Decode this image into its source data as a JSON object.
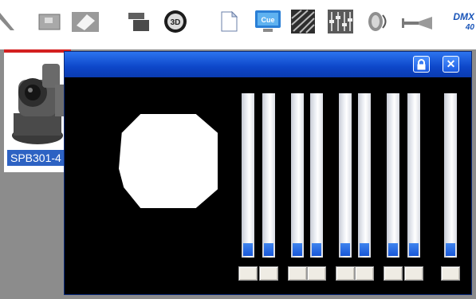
{
  "toolbar": {
    "buttons": [
      {
        "name": "arrow-tool-icon"
      },
      {
        "name": "window-tool-icon"
      },
      {
        "name": "diamond-tool-icon"
      },
      {
        "name": "stack-tool-icon"
      },
      {
        "name": "3d-tool-icon",
        "label": "3D"
      },
      {
        "name": "document-icon"
      },
      {
        "name": "cue-monitor-icon",
        "label": "Cue"
      },
      {
        "name": "striped-panel-icon"
      },
      {
        "name": "mixer-faders-icon"
      },
      {
        "name": "speaker-icon"
      },
      {
        "name": "strobe-icon"
      }
    ],
    "brand_line1": "DMX",
    "brand_line2": "40"
  },
  "device": {
    "label": "SPB301-4"
  },
  "window": {
    "lock_icon": "lock-icon",
    "close_icon": "close-icon",
    "close_glyph": "✕"
  },
  "sliders": [
    {
      "name": "fader-1",
      "level": 0.08
    },
    {
      "name": "fader-2",
      "level": 0.08
    },
    {
      "name": "fader-3",
      "level": 0.08
    },
    {
      "name": "fader-4",
      "level": 0.08
    },
    {
      "name": "fader-5",
      "level": 0.08
    },
    {
      "name": "fader-6",
      "level": 0.08
    },
    {
      "name": "fader-7",
      "level": 0.08
    },
    {
      "name": "fader-8",
      "level": 0.08
    },
    {
      "name": "fader-9",
      "level": 0.08
    }
  ],
  "colors": {
    "accent": "#2d62c3",
    "titlebar": "#1656d8",
    "fader_fill": "#1f63df",
    "device_border": "#d32020"
  }
}
